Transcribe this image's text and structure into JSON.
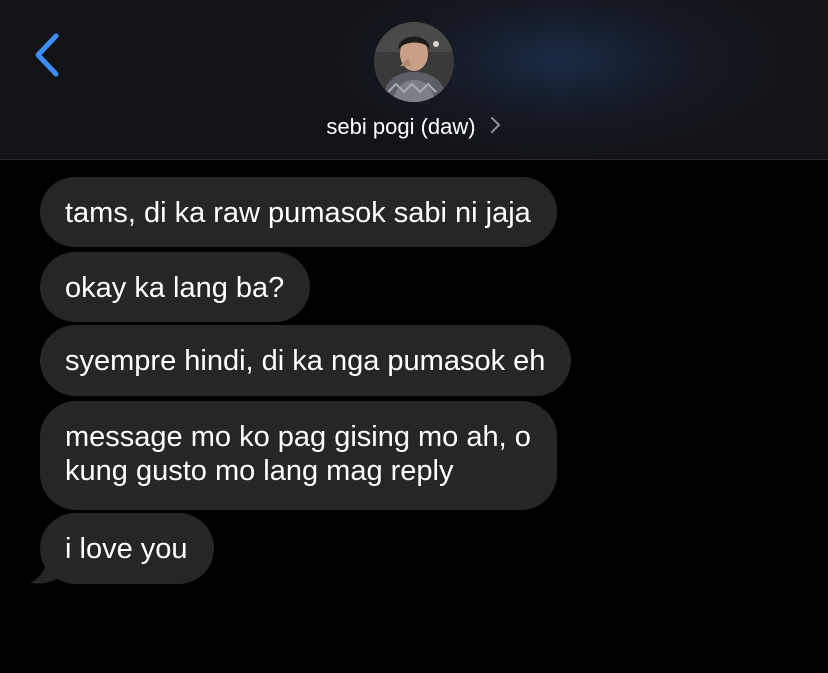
{
  "header": {
    "contact_name": "sebi pogi (daw)",
    "back_icon": "chevron-left-icon",
    "detail_icon": "chevron-right-icon",
    "accent_color": "#3e8ef7"
  },
  "messages": [
    {
      "direction": "received",
      "lines": [
        "tams, di ka raw pumasok sabi ni jaja"
      ]
    },
    {
      "direction": "received",
      "lines": [
        "okay ka lang ba?"
      ]
    },
    {
      "direction": "received",
      "lines": [
        "syempre hindi, di ka nga pumasok eh"
      ]
    },
    {
      "direction": "received",
      "lines": [
        "message mo ko pag gising mo ah, o",
        "kung gusto mo lang mag reply"
      ]
    },
    {
      "direction": "received",
      "lines": [
        "i love you"
      ]
    }
  ],
  "colors": {
    "background": "#000000",
    "received_bubble": "#262628",
    "text": "#ffffff"
  }
}
